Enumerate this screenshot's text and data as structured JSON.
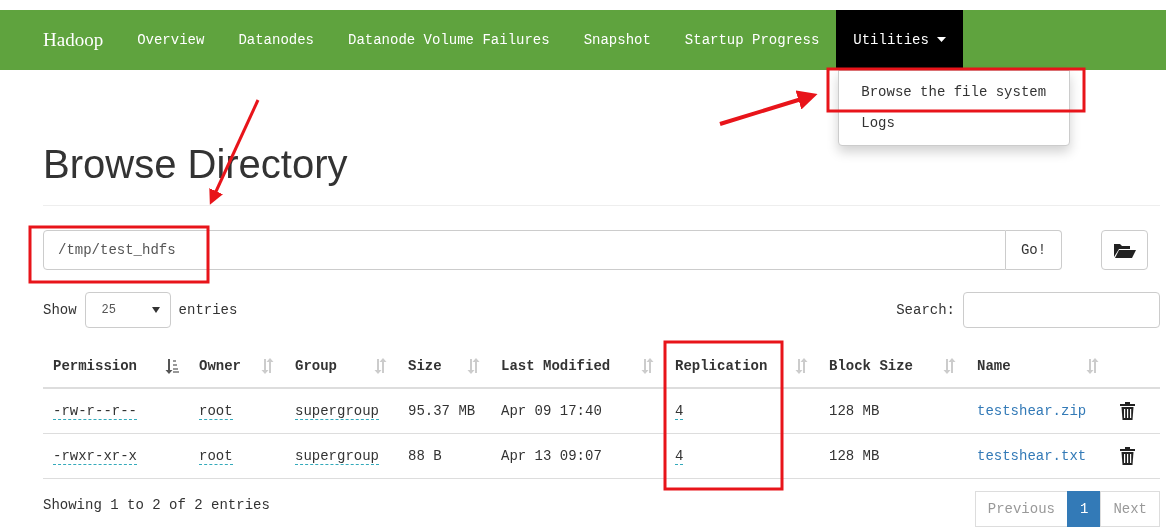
{
  "navbar": {
    "brand": "Hadoop",
    "items": [
      {
        "label": "Overview",
        "selected": false,
        "dropdown": false
      },
      {
        "label": "Datanodes",
        "selected": false,
        "dropdown": false
      },
      {
        "label": "Datanode Volume Failures",
        "selected": false,
        "dropdown": false
      },
      {
        "label": "Snapshot",
        "selected": false,
        "dropdown": false
      },
      {
        "label": "Startup Progress",
        "selected": false,
        "dropdown": false
      },
      {
        "label": "Utilities",
        "selected": true,
        "dropdown": true
      }
    ],
    "menu": {
      "expanded": true,
      "items": [
        "Browse the file system",
        "Logs"
      ]
    }
  },
  "title": "Browse Directory",
  "path": {
    "value": "/tmp/test_hdfs",
    "go": "Go!"
  },
  "length": {
    "before": "Show",
    "value": "25",
    "after": "entries"
  },
  "search": {
    "label": "Search:"
  },
  "table": {
    "columns": [
      {
        "label": "Permission",
        "sorted": true
      },
      {
        "label": "Owner",
        "sorted": false
      },
      {
        "label": "Group",
        "sorted": false
      },
      {
        "label": "Size",
        "sorted": false
      },
      {
        "label": "Last Modified",
        "sorted": false
      },
      {
        "label": "Replication",
        "sorted": false
      },
      {
        "label": "Block Size",
        "sorted": false
      },
      {
        "label": "Name",
        "sorted": false
      }
    ],
    "rows": [
      {
        "permission": "-rw-r--r--",
        "owner": "root",
        "group": "supergroup",
        "size": "95.37 MB",
        "modified": "Apr 09 17:40",
        "replication": "4",
        "block_size": "128 MB",
        "name": "testshear.zip"
      },
      {
        "permission": "-rwxr-xr-x",
        "owner": "root",
        "group": "supergroup",
        "size": "88 B",
        "modified": "Apr 13 09:07",
        "replication": "4",
        "block_size": "128 MB",
        "name": "testshear.txt"
      }
    ]
  },
  "info": "Showing 1 to 2 of 2 entries",
  "pagination": [
    {
      "label": "Previous",
      "selected": false,
      "disabled": true
    },
    {
      "label": "1",
      "selected": true,
      "disabled": false
    },
    {
      "label": "Next",
      "selected": false,
      "disabled": true
    }
  ]
}
